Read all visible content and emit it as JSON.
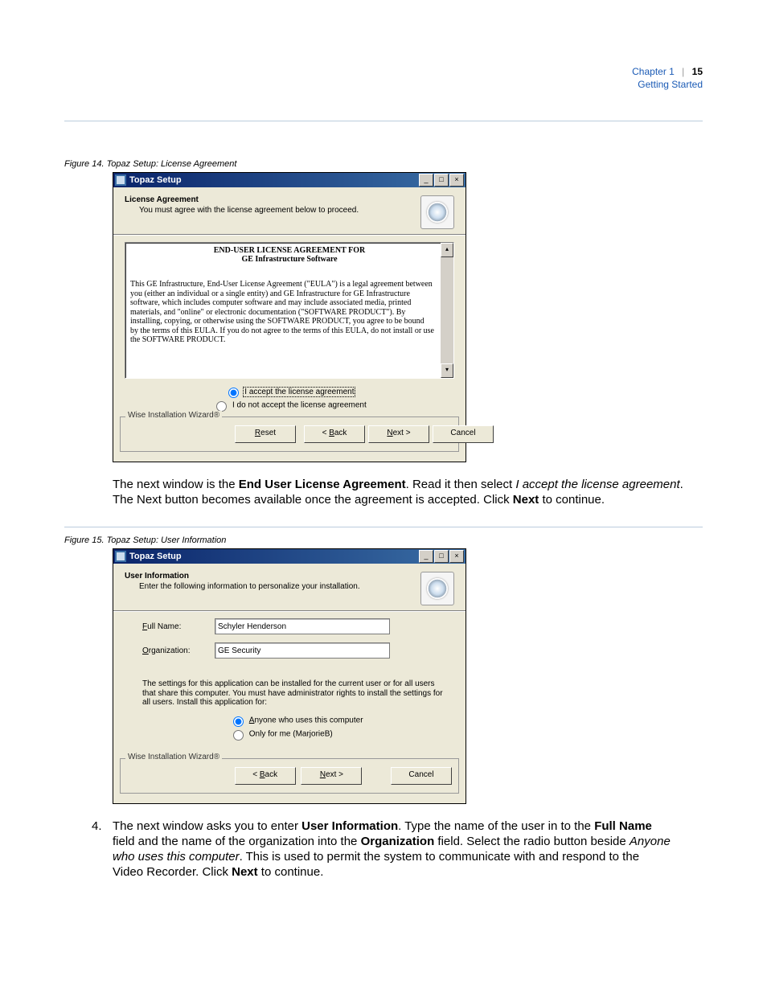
{
  "header": {
    "chapter": "Chapter 1",
    "section": "Getting Started",
    "page": "15"
  },
  "fig14": {
    "caption": "Figure 14. Topaz Setup: License Agreement"
  },
  "dlg1": {
    "title": "Topaz Setup",
    "heading": "License Agreement",
    "sub": "You must agree with the license agreement below to proceed.",
    "eula_title": "END-USER LICENSE AGREEMENT FOR",
    "eula_sub": "GE Infrastructure Software",
    "eula_text": "This GE Infrastructure, End-User License Agreement (\"EULA\") is a legal agreement between you (either an individual or a single entity) and GE Infrastructure for GE Infrastructure software, which includes computer software and may include associated media, printed materials, and \"online\" or electronic documentation (\"SOFTWARE PRODUCT\"). By installing, copying, or otherwise using the SOFTWARE PRODUCT, you agree to be bound by the terms of this EULA. If you do not agree to the terms of this EULA, do not install or use the SOFTWARE PRODUCT.",
    "radio_accept": "I accept the license agreement",
    "radio_decline": "I do not accept the license agreement",
    "legend": "Wise Installation Wizard®",
    "btn_reset_u": "R",
    "btn_reset": "eset",
    "btn_back_pre": "< ",
    "btn_back_u": "B",
    "btn_back": "ack",
    "btn_next_u": "N",
    "btn_next": "ext >",
    "btn_cancel": "Cancel"
  },
  "para1_a": "The next window is the ",
  "para1_b": "End User License Agreement",
  "para1_c": ". Read it then select ",
  "para1_d": "I accept the license agreement",
  "para1_e": ". The Next button becomes available once the agreement is accepted. Click ",
  "para1_f": "Next",
  "para1_g": " to continue.",
  "fig15": {
    "caption": "Figure 15. Topaz Setup: User Information"
  },
  "dlg2": {
    "title": "Topaz Setup",
    "heading": "User Information",
    "sub": "Enter the following information to personalize your installation.",
    "lbl_full_u": "F",
    "lbl_full": "ull Name:",
    "val_full": "Schyler Henderson",
    "lbl_org_u": "O",
    "lbl_org": "rganization:",
    "val_org": "GE Security",
    "info": "The settings for this application can be installed for the current user or for all users that share this computer. You must have administrator rights to install the settings for all users. Install this application for:",
    "radio_anyone_u": "A",
    "radio_anyone": "nyone who uses this computer",
    "radio_me": "Only for me (MarjorieB)",
    "legend": "Wise Installation Wizard®",
    "btn_back_pre": "< ",
    "btn_back_u": "B",
    "btn_back": "ack",
    "btn_next_u": "N",
    "btn_next": "ext >",
    "btn_cancel": "Cancel"
  },
  "step4_num": "4.",
  "step4_a": "The next window asks you to enter ",
  "step4_b": "User Information",
  "step4_c": ". Type the name of the user in to the ",
  "step4_d": "Full Name",
  "step4_e": " field and the name of the organization into the ",
  "step4_f": "Organization",
  "step4_g": " field. Select the radio button beside ",
  "step4_h": "Anyone who uses this computer",
  "step4_i": ". This is used to permit the system to communicate with and respond to the Video Recorder. Click ",
  "step4_j": "Next",
  "step4_k": " to continue."
}
